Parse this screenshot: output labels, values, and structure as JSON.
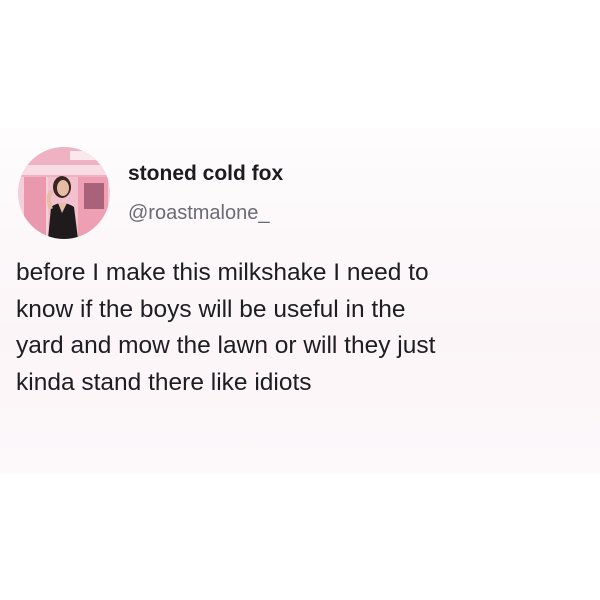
{
  "tweet": {
    "author": {
      "display_name": "stoned cold fox",
      "handle": "@roastmalone_",
      "avatar_icon": "profile-photo-avatar"
    },
    "text_lines": [
      "before I make this milkshake I need to",
      "know if the boys will be useful in the",
      "yard and mow the lawn or will they just",
      "kinda stand there like idiots"
    ]
  },
  "colors": {
    "background": "#ffffff",
    "card_tint": "#fbf5f8",
    "name_text": "#1c1b1f",
    "handle_text": "#6b6b75",
    "body_text": "#1d1d22",
    "avatar_pink": "#f1a6ba"
  }
}
